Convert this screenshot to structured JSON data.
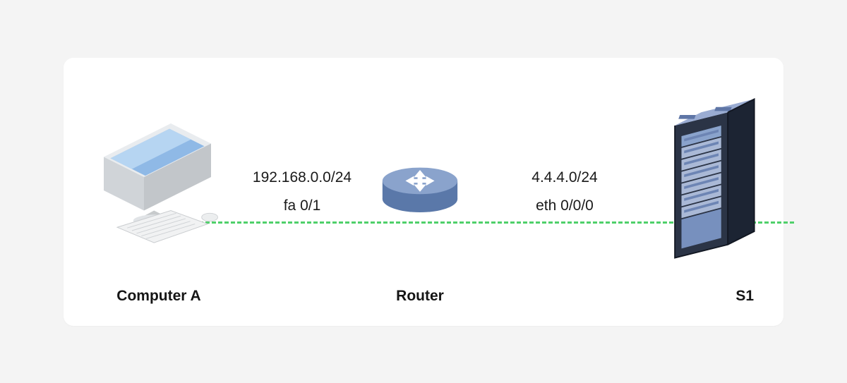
{
  "nodes": {
    "computerA": {
      "label": "Computer A"
    },
    "router": {
      "label": "Router"
    },
    "server": {
      "label": "S1"
    }
  },
  "edges": {
    "computerA_router": {
      "network": "192.168.0.0/24",
      "interface": "fa 0/1"
    },
    "router_server": {
      "network": "4.4.4.0/24",
      "interface": "eth 0/0/0"
    }
  }
}
